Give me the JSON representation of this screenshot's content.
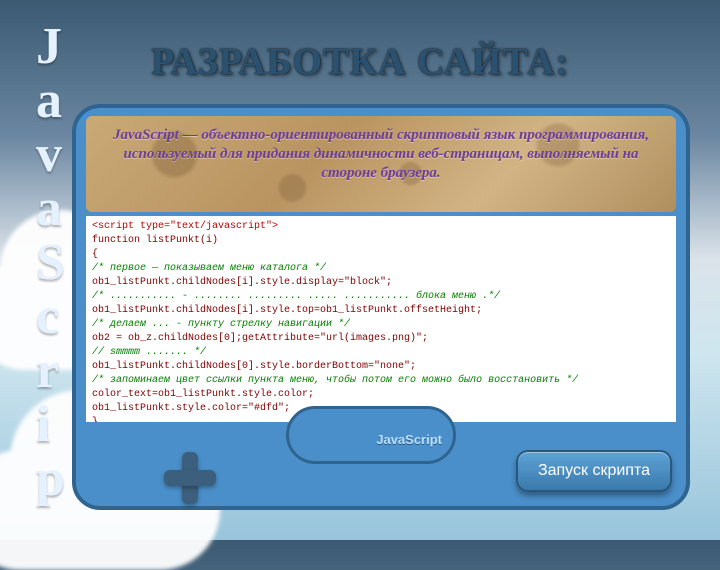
{
  "title": "РАЗРАБОТКА САЙТА:",
  "vertical_letters": [
    "J",
    "a",
    "v",
    "a",
    "S",
    "c",
    "r",
    "i",
    "p"
  ],
  "paper_text": "JavaScript — объектно-ориентированный скриптовый язык программирования, используемый для придания динамичности веб-страницам, выполняемый на стороне браузера.",
  "code_lines": [
    {
      "cls": "c-red",
      "text": "<script type=\"text/javascript\">"
    },
    {
      "cls": "c-mar",
      "text": "function listPunkt(i)"
    },
    {
      "cls": "c-mar",
      "text": "{"
    },
    {
      "cls": "c-grn",
      "text": "/* первое — показываем меню каталога */"
    },
    {
      "cls": "c-mar",
      "text": "ob1_listPunkt.childNodes[i].style.display=\"block\";"
    },
    {
      "cls": "c-grn",
      "text": "/* ........... - ........ ......... ..... ........... блока меню .*/"
    },
    {
      "cls": "c-mar",
      "text": "ob1_listPunkt.childNodes[i].style.top=ob1_listPunkt.offsetHeight;"
    },
    {
      "cls": "c-grn",
      "text": "/* делаем ... - пункту стрелку навигации */"
    },
    {
      "cls": "c-mar",
      "text": "ob2 = ob_z.childNodes[0];getAttribute=\"url(images.png)\";"
    },
    {
      "cls": "c-grn",
      "text": "// smmmm ....... */"
    },
    {
      "cls": "c-mar",
      "text": "ob1_listPunkt.childNodes[0].style.borderBottom=\"none\";"
    },
    {
      "cls": "c-grn",
      "text": "/* запоминаем цвет ссылки пункта меню, чтобы потом его можно было восстановить */"
    },
    {
      "cls": "c-mar",
      "text": "color_text=ob1_listPunkt.style.color;"
    },
    {
      "cls": "c-mar",
      "text": "ob1_listPunkt.style.color=\"#dfd\";"
    },
    {
      "cls": "c-mar",
      "text": "}"
    }
  ],
  "thought_label": "JavaScript",
  "run_button": "Запуск скрипта"
}
